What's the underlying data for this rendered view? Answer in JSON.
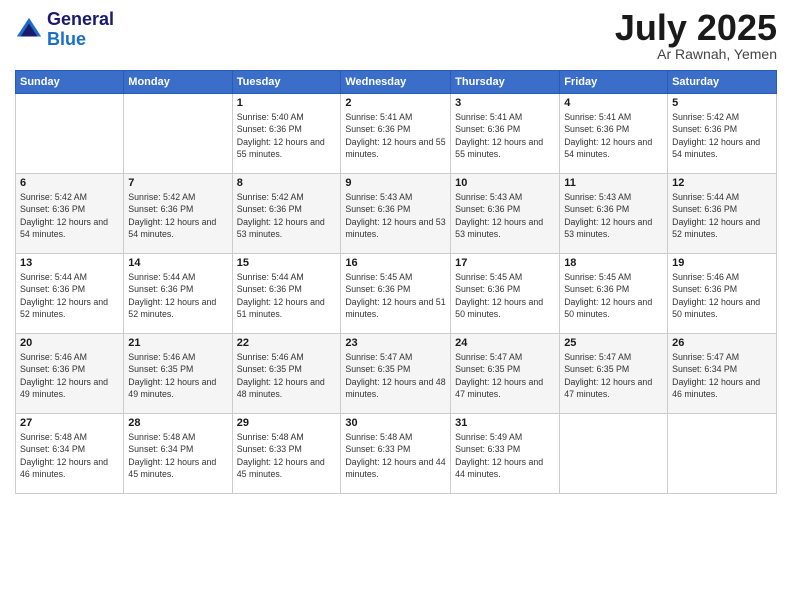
{
  "logo": {
    "line1": "General",
    "line2": "Blue"
  },
  "title": "July 2025",
  "subtitle": "Ar Rawnah, Yemen",
  "days_of_week": [
    "Sunday",
    "Monday",
    "Tuesday",
    "Wednesday",
    "Thursday",
    "Friday",
    "Saturday"
  ],
  "weeks": [
    [
      {
        "day": "",
        "sunrise": "",
        "sunset": "",
        "daylight": ""
      },
      {
        "day": "",
        "sunrise": "",
        "sunset": "",
        "daylight": ""
      },
      {
        "day": "1",
        "sunrise": "Sunrise: 5:40 AM",
        "sunset": "Sunset: 6:36 PM",
        "daylight": "Daylight: 12 hours and 55 minutes."
      },
      {
        "day": "2",
        "sunrise": "Sunrise: 5:41 AM",
        "sunset": "Sunset: 6:36 PM",
        "daylight": "Daylight: 12 hours and 55 minutes."
      },
      {
        "day": "3",
        "sunrise": "Sunrise: 5:41 AM",
        "sunset": "Sunset: 6:36 PM",
        "daylight": "Daylight: 12 hours and 55 minutes."
      },
      {
        "day": "4",
        "sunrise": "Sunrise: 5:41 AM",
        "sunset": "Sunset: 6:36 PM",
        "daylight": "Daylight: 12 hours and 54 minutes."
      },
      {
        "day": "5",
        "sunrise": "Sunrise: 5:42 AM",
        "sunset": "Sunset: 6:36 PM",
        "daylight": "Daylight: 12 hours and 54 minutes."
      }
    ],
    [
      {
        "day": "6",
        "sunrise": "Sunrise: 5:42 AM",
        "sunset": "Sunset: 6:36 PM",
        "daylight": "Daylight: 12 hours and 54 minutes."
      },
      {
        "day": "7",
        "sunrise": "Sunrise: 5:42 AM",
        "sunset": "Sunset: 6:36 PM",
        "daylight": "Daylight: 12 hours and 54 minutes."
      },
      {
        "day": "8",
        "sunrise": "Sunrise: 5:42 AM",
        "sunset": "Sunset: 6:36 PM",
        "daylight": "Daylight: 12 hours and 53 minutes."
      },
      {
        "day": "9",
        "sunrise": "Sunrise: 5:43 AM",
        "sunset": "Sunset: 6:36 PM",
        "daylight": "Daylight: 12 hours and 53 minutes."
      },
      {
        "day": "10",
        "sunrise": "Sunrise: 5:43 AM",
        "sunset": "Sunset: 6:36 PM",
        "daylight": "Daylight: 12 hours and 53 minutes."
      },
      {
        "day": "11",
        "sunrise": "Sunrise: 5:43 AM",
        "sunset": "Sunset: 6:36 PM",
        "daylight": "Daylight: 12 hours and 53 minutes."
      },
      {
        "day": "12",
        "sunrise": "Sunrise: 5:44 AM",
        "sunset": "Sunset: 6:36 PM",
        "daylight": "Daylight: 12 hours and 52 minutes."
      }
    ],
    [
      {
        "day": "13",
        "sunrise": "Sunrise: 5:44 AM",
        "sunset": "Sunset: 6:36 PM",
        "daylight": "Daylight: 12 hours and 52 minutes."
      },
      {
        "day": "14",
        "sunrise": "Sunrise: 5:44 AM",
        "sunset": "Sunset: 6:36 PM",
        "daylight": "Daylight: 12 hours and 52 minutes."
      },
      {
        "day": "15",
        "sunrise": "Sunrise: 5:44 AM",
        "sunset": "Sunset: 6:36 PM",
        "daylight": "Daylight: 12 hours and 51 minutes."
      },
      {
        "day": "16",
        "sunrise": "Sunrise: 5:45 AM",
        "sunset": "Sunset: 6:36 PM",
        "daylight": "Daylight: 12 hours and 51 minutes."
      },
      {
        "day": "17",
        "sunrise": "Sunrise: 5:45 AM",
        "sunset": "Sunset: 6:36 PM",
        "daylight": "Daylight: 12 hours and 50 minutes."
      },
      {
        "day": "18",
        "sunrise": "Sunrise: 5:45 AM",
        "sunset": "Sunset: 6:36 PM",
        "daylight": "Daylight: 12 hours and 50 minutes."
      },
      {
        "day": "19",
        "sunrise": "Sunrise: 5:46 AM",
        "sunset": "Sunset: 6:36 PM",
        "daylight": "Daylight: 12 hours and 50 minutes."
      }
    ],
    [
      {
        "day": "20",
        "sunrise": "Sunrise: 5:46 AM",
        "sunset": "Sunset: 6:36 PM",
        "daylight": "Daylight: 12 hours and 49 minutes."
      },
      {
        "day": "21",
        "sunrise": "Sunrise: 5:46 AM",
        "sunset": "Sunset: 6:35 PM",
        "daylight": "Daylight: 12 hours and 49 minutes."
      },
      {
        "day": "22",
        "sunrise": "Sunrise: 5:46 AM",
        "sunset": "Sunset: 6:35 PM",
        "daylight": "Daylight: 12 hours and 48 minutes."
      },
      {
        "day": "23",
        "sunrise": "Sunrise: 5:47 AM",
        "sunset": "Sunset: 6:35 PM",
        "daylight": "Daylight: 12 hours and 48 minutes."
      },
      {
        "day": "24",
        "sunrise": "Sunrise: 5:47 AM",
        "sunset": "Sunset: 6:35 PM",
        "daylight": "Daylight: 12 hours and 47 minutes."
      },
      {
        "day": "25",
        "sunrise": "Sunrise: 5:47 AM",
        "sunset": "Sunset: 6:35 PM",
        "daylight": "Daylight: 12 hours and 47 minutes."
      },
      {
        "day": "26",
        "sunrise": "Sunrise: 5:47 AM",
        "sunset": "Sunset: 6:34 PM",
        "daylight": "Daylight: 12 hours and 46 minutes."
      }
    ],
    [
      {
        "day": "27",
        "sunrise": "Sunrise: 5:48 AM",
        "sunset": "Sunset: 6:34 PM",
        "daylight": "Daylight: 12 hours and 46 minutes."
      },
      {
        "day": "28",
        "sunrise": "Sunrise: 5:48 AM",
        "sunset": "Sunset: 6:34 PM",
        "daylight": "Daylight: 12 hours and 45 minutes."
      },
      {
        "day": "29",
        "sunrise": "Sunrise: 5:48 AM",
        "sunset": "Sunset: 6:33 PM",
        "daylight": "Daylight: 12 hours and 45 minutes."
      },
      {
        "day": "30",
        "sunrise": "Sunrise: 5:48 AM",
        "sunset": "Sunset: 6:33 PM",
        "daylight": "Daylight: 12 hours and 44 minutes."
      },
      {
        "day": "31",
        "sunrise": "Sunrise: 5:49 AM",
        "sunset": "Sunset: 6:33 PM",
        "daylight": "Daylight: 12 hours and 44 minutes."
      },
      {
        "day": "",
        "sunrise": "",
        "sunset": "",
        "daylight": ""
      },
      {
        "day": "",
        "sunrise": "",
        "sunset": "",
        "daylight": ""
      }
    ]
  ]
}
